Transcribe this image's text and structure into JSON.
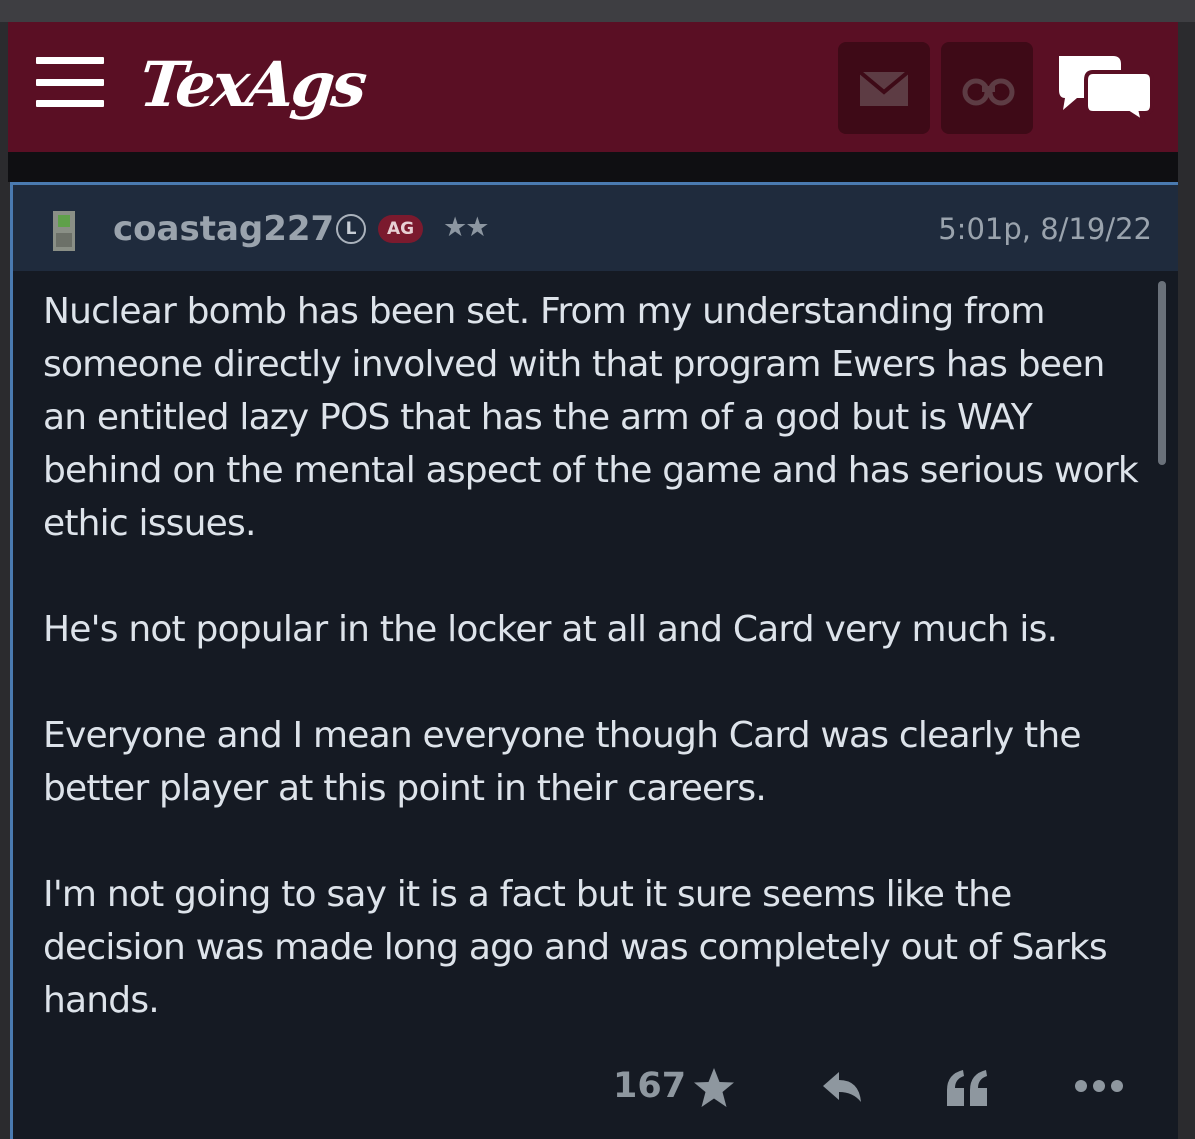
{
  "header": {
    "logo_text": "TexAgs",
    "brand_color": "#5a0f24",
    "icons": [
      "menu-icon",
      "mail-icon",
      "binoculars-icon",
      "chat-icon"
    ]
  },
  "post": {
    "username": "coastag227",
    "badge_l": "L",
    "badge_ag": "AG",
    "stars": "★★",
    "timestamp": "5:01p, 8/19/22",
    "paragraphs": [
      "Nuclear bomb has been set. From my understanding from someone directly involved with that program Ewers has been an entitled lazy POS that has the arm of a god but is WAY behind on the mental aspect of the game and has serious work ethic issues.",
      "He's not popular in the locker at all and Card very much is.",
      "Everyone and I mean everyone though Card was clearly the better player at this point in their careers.",
      "I'm not going to say it is a fact but it sure seems like the decision was made long ago and was completely out of Sarks hands."
    ],
    "score": "167",
    "action_icons": [
      "star-icon",
      "reply-icon",
      "quote-icon",
      "more-icon"
    ]
  }
}
